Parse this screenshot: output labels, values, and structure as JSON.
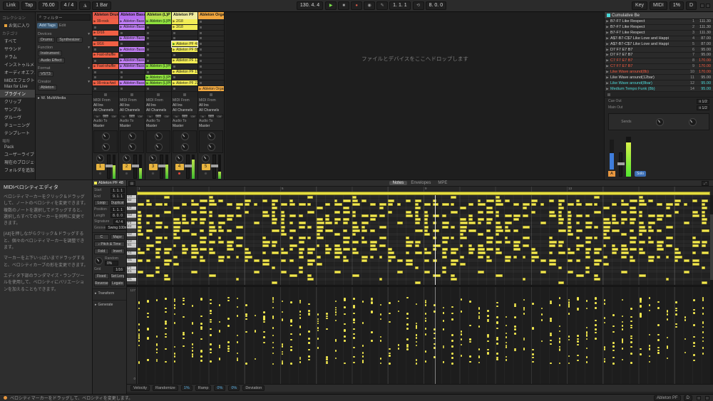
{
  "toolbar": {
    "link": "Link",
    "tap": "Tap",
    "tempo": "76.00",
    "signature": "4 / 4",
    "quantize": "1 Bar",
    "position": "130. 4. 4",
    "loop_start": "1. 1. 1",
    "loop_length": "8. 0. 0",
    "key_label": "Key",
    "midi_label": "MIDI",
    "cpu": "1%",
    "disk": "D"
  },
  "browser": {
    "collections_header": "コレクション",
    "collection_items": [
      {
        "label": "お気に入り",
        "color": "#e8a33d"
      }
    ],
    "categories_header": "カテゴリ",
    "categories": [
      "すべて",
      "サウンド",
      "ドラム",
      "インストゥルメント",
      "オーディオエフェクト",
      "MIDIエフェクト",
      "Max for Live",
      "プラグイン",
      "クリップ",
      "サンプル",
      "グルーヴ",
      "チューニング",
      "テンプレート"
    ],
    "selected_category": "プラグイン",
    "places_header": "場所",
    "places": [
      "Pack",
      "ユーザーライブラリ",
      "現在のプロジェクト",
      "フォルダを追加"
    ],
    "filter": {
      "search": "フィルター",
      "add_tags": "Add Tags",
      "edit": "Edit",
      "groups": [
        {
          "name": "Devices",
          "items": [
            "Drums",
            "Synthesizer"
          ]
        },
        {
          "name": "Function",
          "items": [
            "Instrument",
            "Audio Effect"
          ]
        },
        {
          "name": "Format",
          "items": [
            "VST3"
          ]
        },
        {
          "name": "Creator",
          "items": [
            "Ableton"
          ]
        }
      ],
      "results": [
        "W. MultiMedia"
      ]
    }
  },
  "session": {
    "drop_hint": "ファイルとデバイスをここへドロップします",
    "tracks": [
      {
        "name": "Ableton Drums",
        "color": "#e85a4a",
        "clip_color": "#f06045",
        "slots": [
          {
            "t": "clip",
            "n": "99-rock"
          },
          {
            "t": "stop"
          },
          {
            "t": "clip",
            "n": "D/16"
          },
          {
            "t": "stop"
          },
          {
            "t": "clip",
            "n": "0/16"
          },
          {
            "t": "stop"
          },
          {
            "t": "clip",
            "n": "Fast-shuffle"
          },
          {
            "t": "stop"
          },
          {
            "t": "clip",
            "n": "Fast-shuffle"
          },
          {
            "t": "stop"
          },
          {
            "t": "stop"
          },
          {
            "t": "clip",
            "n": "99-nica-fwd"
          },
          {
            "t": "stop"
          }
        ]
      },
      {
        "name": "Ableton Bass",
        "color": "#b66df0",
        "clip_color": "#c07ef5",
        "slots": [
          {
            "t": "clip",
            "n": "Ableton Bass"
          },
          {
            "t": "clip",
            "n": "Ableton Bass 2"
          },
          {
            "t": "stop"
          },
          {
            "t": "clip",
            "n": "Ableton Bass 3"
          },
          {
            "t": "stop"
          },
          {
            "t": "clip",
            "n": "Ableton Bass 4"
          },
          {
            "t": "stop"
          },
          {
            "t": "clip",
            "n": "Ableton Bass 5"
          },
          {
            "t": "clip",
            "n": "Ableton Bass 6"
          },
          {
            "t": "stop"
          },
          {
            "t": "stop"
          },
          {
            "t": "clip",
            "n": "Ableton Bass 7"
          },
          {
            "t": "stop"
          }
        ]
      },
      {
        "name": "Ableton (L)P",
        "color": "#b8e04e",
        "clip_color": "#8fe23e",
        "slots": [
          {
            "t": "clip",
            "n": "Ableton (L)Pf"
          },
          {
            "t": "stop"
          },
          {
            "t": "stop"
          },
          {
            "t": "stop"
          },
          {
            "t": "stop"
          },
          {
            "t": "stop"
          },
          {
            "t": "stop"
          },
          {
            "t": "stop"
          },
          {
            "t": "clip",
            "n": "Ableton (L)Pf 2"
          },
          {
            "t": "stop"
          },
          {
            "t": "clip",
            "n": "Ableton (L)Pf 3",
            "play": true
          },
          {
            "t": "clip",
            "n": "Ableton (L)Pf 4"
          },
          {
            "t": "stop"
          }
        ]
      },
      {
        "name": "Ableton PF",
        "color": "#f0eda0",
        "clip_color": "#f2ec55",
        "slots": [
          {
            "t": "clip",
            "n": "2/18"
          },
          {
            "t": "clip",
            "n": "3/18"
          },
          {
            "t": "stop"
          },
          {
            "t": "stop"
          },
          {
            "t": "clip",
            "n": "Ableton PF 48",
            "play": true,
            "sel": true
          },
          {
            "t": "clip",
            "n": "Ableton PF 80"
          },
          {
            "t": "stop"
          },
          {
            "t": "clip",
            "n": "Ableton PF 13"
          },
          {
            "t": "stop"
          },
          {
            "t": "clip",
            "n": "Ableton PF 15"
          },
          {
            "t": "stop"
          },
          {
            "t": "clip",
            "n": "Ableton PF 22"
          },
          {
            "t": "stop"
          }
        ]
      },
      {
        "name": "Ableton Organ",
        "color": "#f0a63e",
        "clip_color": "#f2aa42",
        "slots": [
          {
            "t": "stop"
          },
          {
            "t": "stop"
          },
          {
            "t": "stop"
          },
          {
            "t": "stop"
          },
          {
            "t": "stop"
          },
          {
            "t": "stop"
          },
          {
            "t": "stop"
          },
          {
            "t": "stop"
          },
          {
            "t": "stop"
          },
          {
            "t": "stop"
          },
          {
            "t": "stop"
          },
          {
            "t": "stop"
          },
          {
            "t": "clip",
            "n": "Ableton Organ"
          }
        ]
      }
    ],
    "mixer": {
      "midi_from": "MIDI From",
      "input": "All Ins",
      "channel": "All Channels",
      "monitor": [
        "In",
        "Auto",
        "Off"
      ],
      "audio_to": "Audio To",
      "out": "Master",
      "activators": [
        "1",
        "2",
        "3",
        "4",
        "5"
      ],
      "levels": [
        0.55,
        0.45,
        0.6,
        0.78,
        0.3
      ],
      "armed": [
        false,
        false,
        false,
        true,
        false
      ]
    }
  },
  "master": {
    "header": "Cumulative Be",
    "scenes": [
      {
        "name": "B7-F7  Like Respect",
        "num": "1",
        "tempo": "111.30",
        "color": "normal"
      },
      {
        "name": "B7-F7  Like Respect",
        "num": "2",
        "tempo": "111.30",
        "color": "normal"
      },
      {
        "name": "B7-F7  Like Respect",
        "num": "3",
        "tempo": "111.30",
        "color": "normal"
      },
      {
        "name": "A$7-B7-C$7 Like Love and Happi",
        "num": "4",
        "tempo": "87.00",
        "color": "normal"
      },
      {
        "name": "A$7-B7-C$7 Like Love and Happi",
        "num": "5",
        "tempo": "87.00",
        "color": "normal"
      },
      {
        "name": "D7 F7 E7 B7",
        "num": "6",
        "tempo": "95.00",
        "color": "normal"
      },
      {
        "name": "D7 F7 E7 B7",
        "num": "7",
        "tempo": "95.00",
        "color": "normal"
      },
      {
        "name": "C7 F7 E7 B7",
        "num": "8",
        "tempo": "170.00",
        "color": "red"
      },
      {
        "name": "C7 F7 E7 B7",
        "num": "9",
        "tempo": "170.00",
        "color": "red"
      },
      {
        "name": "Like Wave around(8b)",
        "num": "10",
        "tempo": "170.00",
        "color": "red"
      },
      {
        "name": "Like Wave around(12bar)",
        "num": "11",
        "tempo": "95.00",
        "color": "normal"
      },
      {
        "name": "Like Wave around(8bar)",
        "num": "12",
        "tempo": "95.00",
        "color": "cyan"
      },
      {
        "name": "Medium Tempo Funk (8b)",
        "num": "14",
        "tempo": "95.00",
        "color": "cyan"
      }
    ],
    "cue_out_label": "Cue Out",
    "cue_out": "ii 1/2",
    "main_out_label": "Main Out",
    "main_out": "ii 1/2",
    "sends_label": "Sends",
    "crossfade_a": "A",
    "solo": "Solo"
  },
  "help": {
    "title": "MIDIベロシティエディタ",
    "paragraphs": [
      "ベロシティマーカーをクリック＆ドラッグして、ノートのベロシティを変更できます。複数のノートを選択してドラッグすると、選択したすべてのマーカーを同時に変更できます。",
      "[Alt]を押しながらクリック＆ドラッグすると、個々のベロシティマーカーを調整できます。",
      "マーカーを上下いっぱいまでドラッグすると、ベロシティカーブの形を変更できます。",
      "エディタ下部のランダマイズ・ランプツールを使用して、ベロシティにバリエーションを加えることもできます。"
    ]
  },
  "clip": {
    "title": "Ableton PF 48",
    "rows": [
      {
        "label": "Start",
        "value": "1. 1. 1"
      },
      {
        "label": "End",
        "value": "9. 1. 1"
      },
      {
        "label": "Position",
        "value": "1. 1. 1"
      },
      {
        "label": "Length",
        "value": "8. 0. 0"
      },
      {
        "label": "Signature",
        "value": "4 / 4"
      },
      {
        "label": "Groove",
        "value": "Swing 100ms"
      }
    ],
    "loop": "Loop",
    "duplicate": "Duplicate",
    "scale_root": "C",
    "scale_name": "Major",
    "pitch_time": "♪ Pitch & Time",
    "fold": "Fold",
    "invert": "Invert",
    "random_label": "Random",
    "random_pct": "0%",
    "grid_label": "Grid",
    "grid_value": "1/16",
    "set_length": "Set Length",
    "fixed": "Fixed",
    "reverse": "Reverse",
    "legato": "Legato",
    "transform": "Transform",
    "generate": "Generate"
  },
  "editor": {
    "tabs": [
      "Notes",
      "Envelopes",
      "MPE"
    ],
    "active_tab": "Notes",
    "ruler": [
      "1",
      "5",
      "9",
      "13"
    ],
    "keys": [
      "C3",
      "B2",
      "A#2",
      "A2",
      "G#2",
      "G2",
      "F#2",
      "F2",
      "E2",
      "D#2",
      "D2",
      "C#2",
      "C2",
      "B1",
      "A#1",
      "A1",
      "G#1",
      "G1",
      "F#1",
      "F1",
      "E1",
      "D#1",
      "D1",
      "C#1"
    ],
    "vel_marks": [
      "127",
      "0"
    ],
    "pattern": {
      "seed": 11,
      "sections": 4,
      "cols": 16,
      "densities": [
        0.18,
        0.5,
        0.55,
        0.5,
        0.55,
        0.5,
        0.45,
        0.5,
        0.45,
        0.5,
        0.33,
        0.3,
        0.33,
        0.3,
        0.42,
        0.4,
        0.42,
        0.4,
        0.2,
        0.18,
        0.2,
        0.15,
        0.12,
        0.12
      ]
    },
    "playhead_frac": 0.52,
    "footer": {
      "lane": "Velocity",
      "randomize": "Randomize",
      "randomize_pct": "1%",
      "ramp": "Ramp",
      "ramp_pct": "0%",
      "ramp_pct2": "0%",
      "deviation": "Deviation"
    }
  },
  "statusbar": {
    "left": "ベロシティマーカーをドラッグして、ベロシティを変更します。",
    "device": "Ableton PF",
    "disk": "D"
  }
}
